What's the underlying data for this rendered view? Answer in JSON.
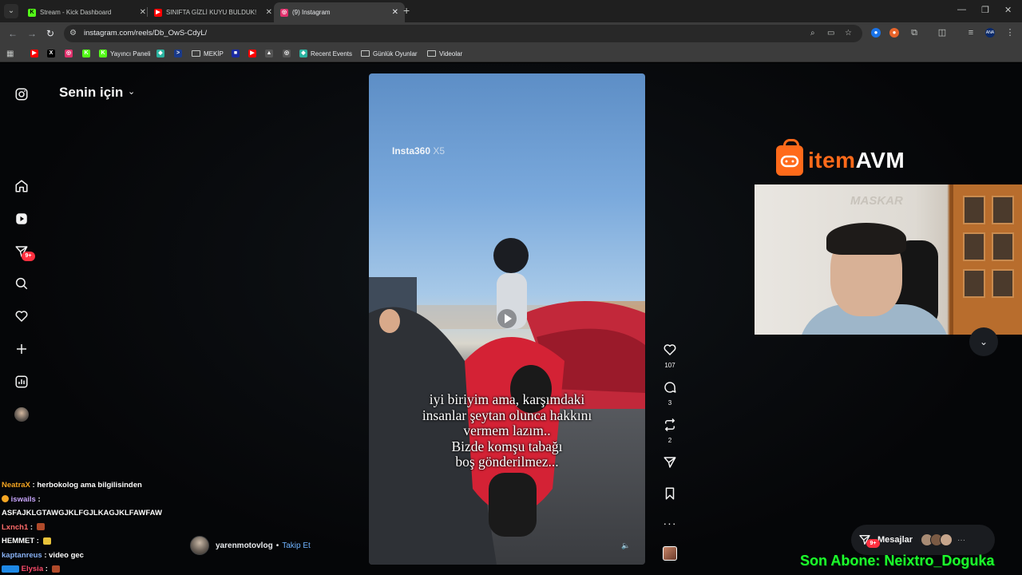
{
  "browser": {
    "tabs": [
      {
        "title": "Stream - Kick Dashboard",
        "fav_color": "#53fc18",
        "fav_char": "K",
        "active": false
      },
      {
        "title": "SINIFTA GİZLİ KUYU BULDUK!",
        "fav_color": "#ff0000",
        "fav_char": "▶",
        "active": false
      },
      {
        "title": "(9) Instagram",
        "fav_color": "#e1306c",
        "fav_char": "◎",
        "active": true
      }
    ],
    "url": "instagram.com/reels/Db_OwS-CdyL/",
    "bookmarks": [
      {
        "label": "",
        "icon": "youtube-icon",
        "color": "#ff0000",
        "char": "▶"
      },
      {
        "label": "",
        "icon": "x-icon",
        "color": "#000000",
        "char": "X"
      },
      {
        "label": "",
        "icon": "instagram-icon",
        "color": "#e1306c",
        "char": "◎"
      },
      {
        "label": "",
        "icon": "kick-icon",
        "color": "#53fc18",
        "char": "K"
      },
      {
        "label": "Yayıncı Paneli",
        "icon": "kick-icon",
        "color": "#53fc18",
        "char": "K"
      },
      {
        "label": "",
        "icon": "app-icon",
        "color": "#2bb3a0",
        "char": "◆"
      },
      {
        "label": "",
        "icon": "terminal-icon",
        "color": "#1a3a8a",
        "char": ">"
      },
      {
        "label": "MEKİP",
        "icon": "folder-icon",
        "color": "",
        "char": ""
      },
      {
        "label": "",
        "icon": "app-icon",
        "color": "#1a2aa0",
        "char": "■"
      },
      {
        "label": "",
        "icon": "youtube-icon",
        "color": "#ff0000",
        "char": "▶"
      },
      {
        "label": "",
        "icon": "image-icon",
        "color": "#555555",
        "char": "▲"
      },
      {
        "label": "",
        "icon": "settings-icon",
        "color": "#555555",
        "char": "◎"
      },
      {
        "label": "Recent Events",
        "icon": "events-icon",
        "color": "#2bb3a0",
        "char": "◆"
      },
      {
        "label": "Günlük Oyunlar",
        "icon": "folder-icon",
        "color": "",
        "char": ""
      },
      {
        "label": "Videolar",
        "icon": "folder-icon",
        "color": "",
        "char": ""
      }
    ]
  },
  "instagram": {
    "feed_title": "Senin için",
    "nav_badge": "9+",
    "reel": {
      "watermark_brand": "Insta360",
      "watermark_model": " X5",
      "caption_lines": [
        "iyi biriyim ama, karşımdaki",
        "insanlar şeytan olunca hakkını",
        "vermem lazım..",
        "Bizde komşu tabağı",
        "boş gönderilmez..."
      ],
      "likes": "107",
      "comments": "3",
      "reposts": "2",
      "author": "yarenmotovlog",
      "follow_label": "Takip Et"
    },
    "messages_label": "Mesajlar",
    "messages_badge": "9+"
  },
  "overlay": {
    "sponsor_prefix": "item",
    "sponsor_suffix": "AVM",
    "webcam_watermark": "MASKAR",
    "last_sub": "Son Abone: Neixtro_Doguka",
    "chat": [
      {
        "user": "NeatraX",
        "color": "#f5a623",
        "text": "herbokolog ama bilgilisinden",
        "emote": ""
      },
      {
        "user": "iswails",
        "color": "#c9a7ff",
        "text": "",
        "emote": "",
        "badge": true
      },
      {
        "user": "",
        "color": "#ffffff",
        "text": "ASFAJKLGTAWGJKLFGJLKAGJKLFAWFAW",
        "emote": ""
      },
      {
        "user": "Lxnch1",
        "color": "#ff6b6b",
        "text": "",
        "emote": "#b04a2a"
      },
      {
        "user": "HEMMET",
        "color": "#ffffff",
        "text": "",
        "emote": "#e8c23a"
      },
      {
        "user": "kaptanreus",
        "color": "#8ab4f8",
        "text": "video gec",
        "emote": ""
      },
      {
        "user": "Elysia",
        "color": "#ff4d6d",
        "text": "",
        "emote": "#b04a2a"
      }
    ]
  }
}
